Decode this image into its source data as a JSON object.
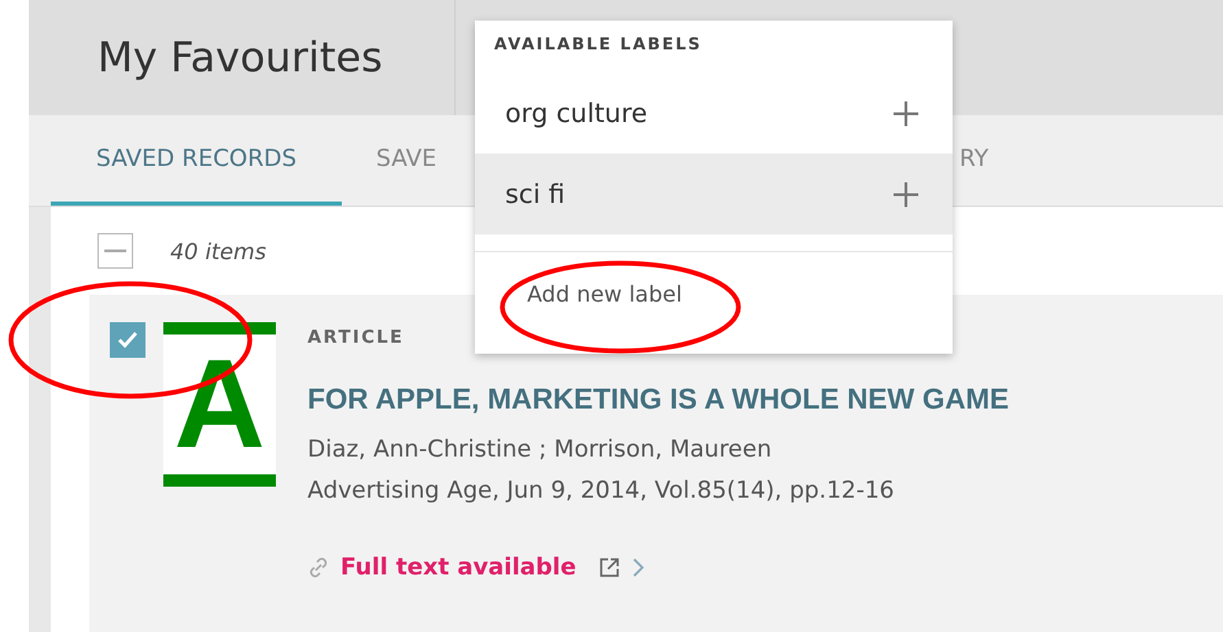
{
  "header": {
    "title": "My Favourites"
  },
  "tabs": [
    {
      "label": "SAVED RECORDS",
      "selected": true
    },
    {
      "label": "SAVE",
      "selected": false
    },
    {
      "label": "RY",
      "selected": false
    }
  ],
  "toolbar": {
    "select_all_indeterminate": true,
    "count": "40 items"
  },
  "records": [
    {
      "checked": true,
      "type": "ARTICLE",
      "title": "FOR APPLE, MARKETING IS A WHOLE NEW GAME",
      "authors": "Diaz, Ann-Christine ; Morrison, Maureen",
      "source": "Advertising Age, Jun 9, 2014, Vol.85(14), pp.12-16",
      "thumbnail_letter": "A",
      "availability": "Full text available"
    }
  ],
  "labels_menu": {
    "heading": "AVAILABLE LABELS",
    "items": [
      {
        "label": "org culture",
        "selected": false
      },
      {
        "label": "sci fi",
        "selected": true
      }
    ],
    "add_label": "Add new label"
  },
  "annotations": [
    {
      "kind": "ellipse"
    },
    {
      "kind": "ellipse"
    }
  ]
}
